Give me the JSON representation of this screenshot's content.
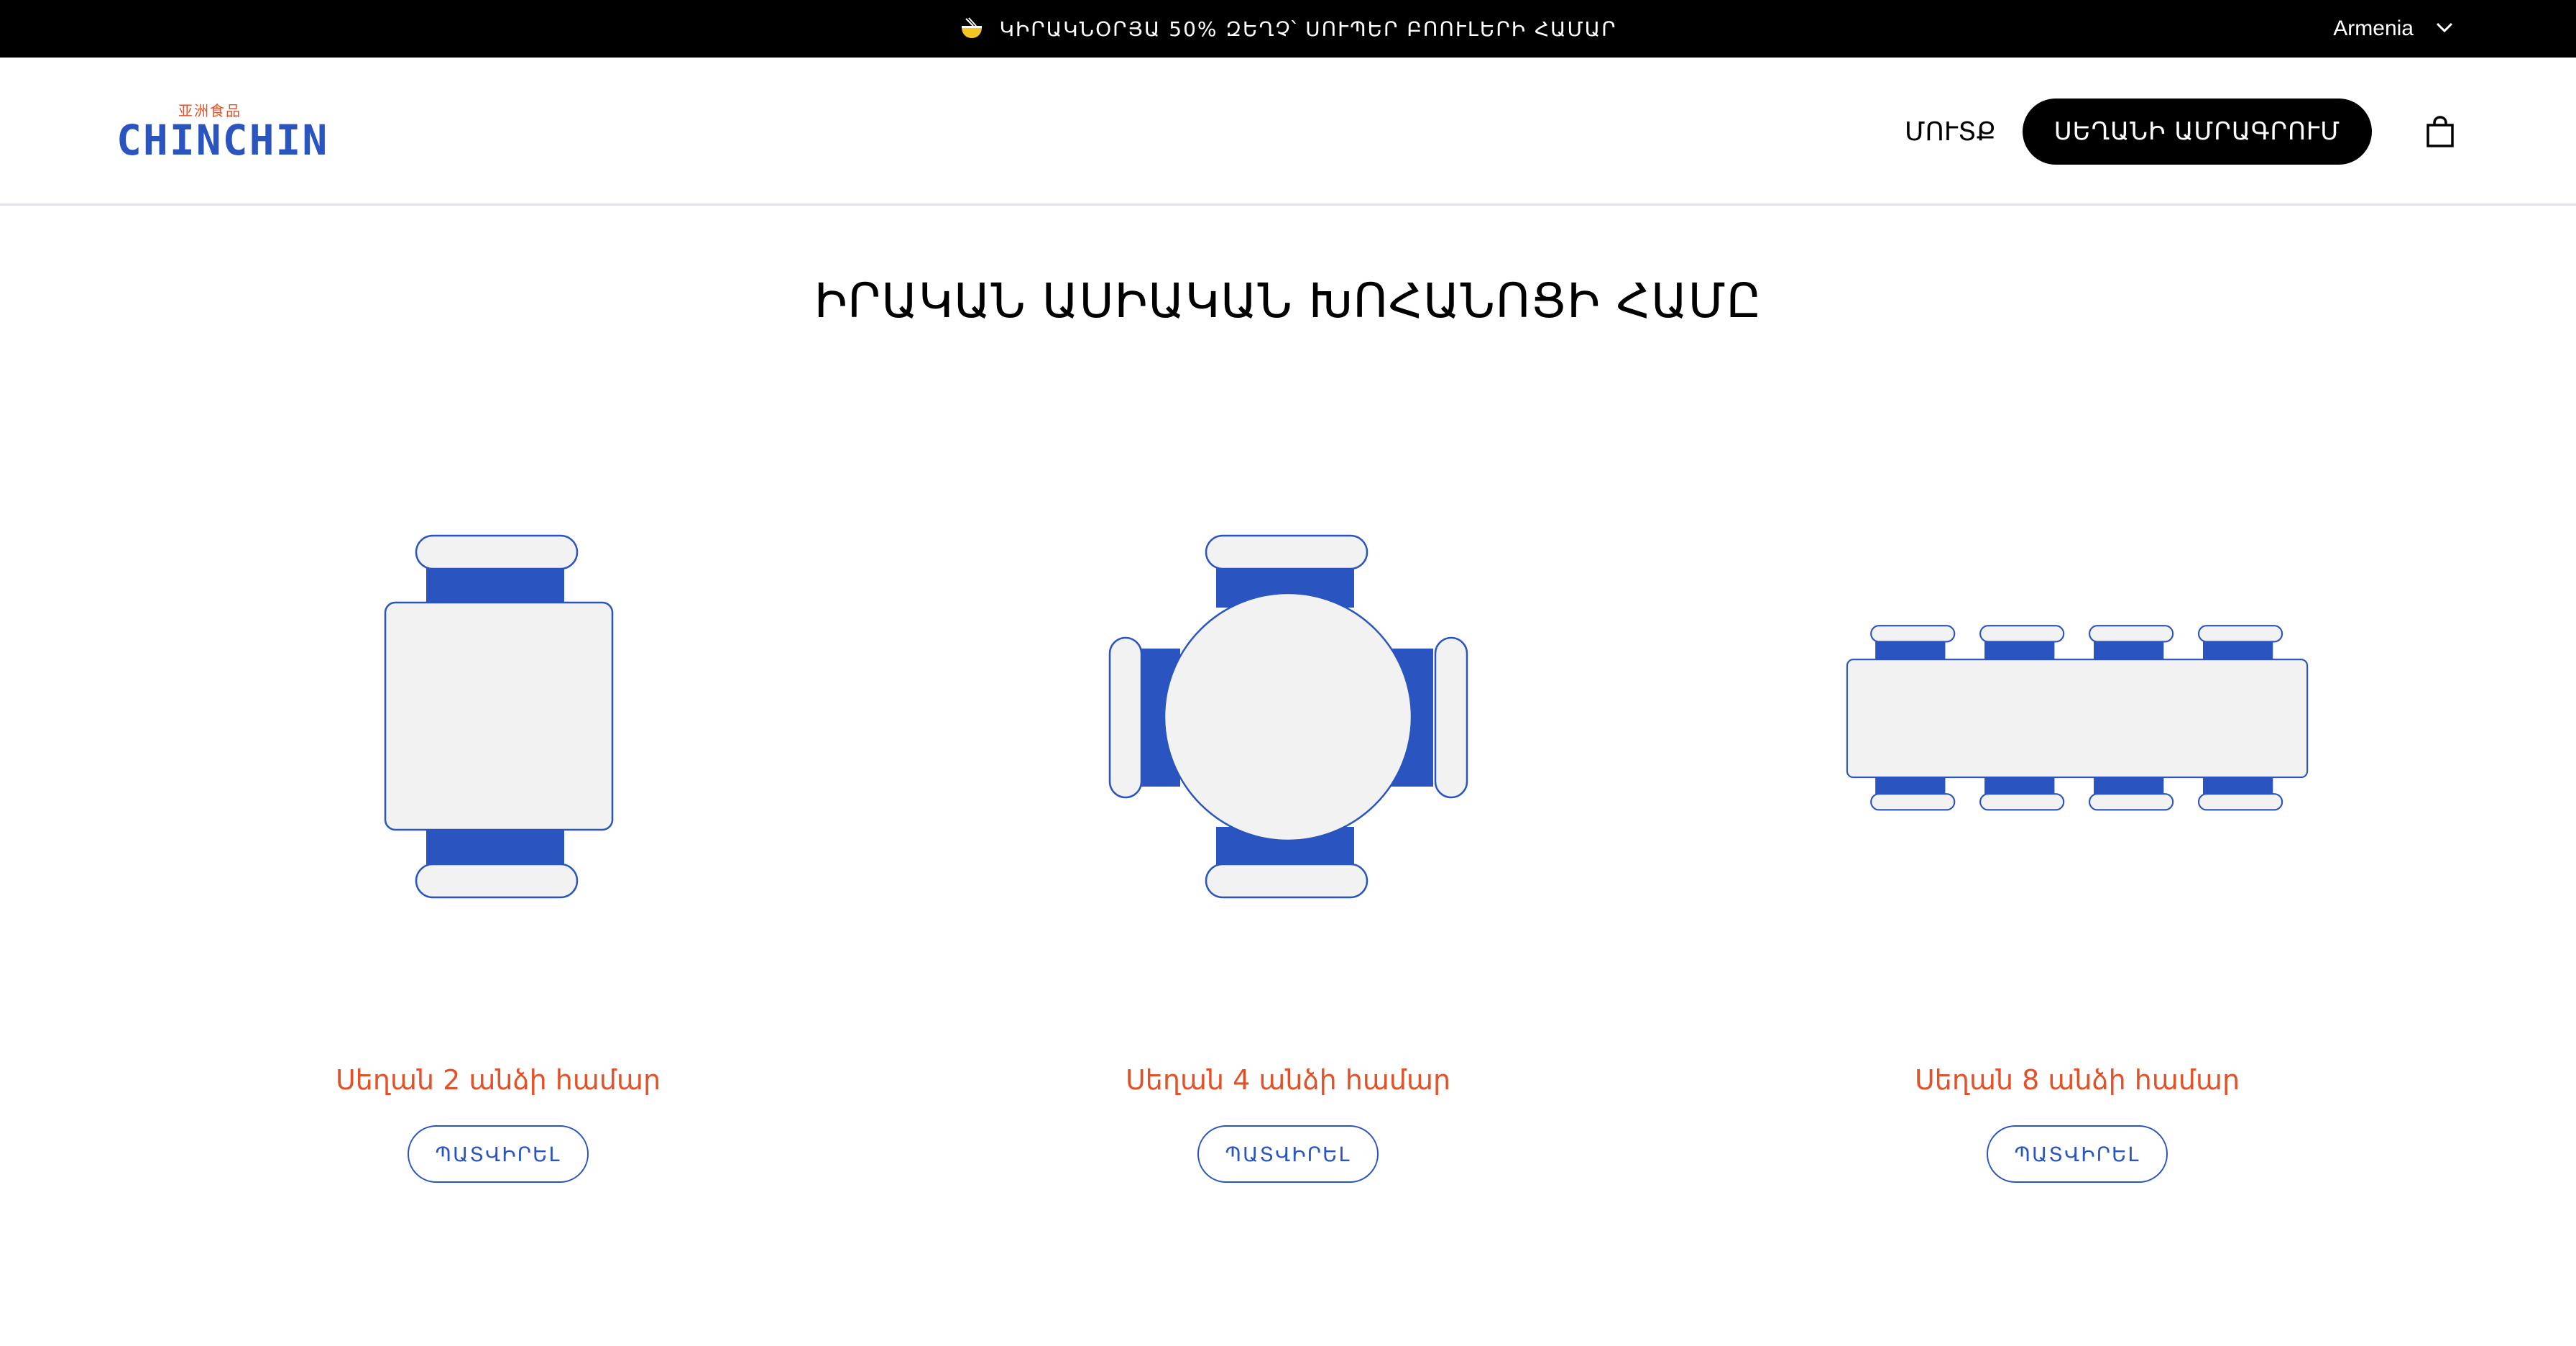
{
  "promo": {
    "icon": "noodle-bowl-icon",
    "text": "ԿԻՐԱԿՆՕՐՅԱ 50% ԶԵՂՉ՝ ՍՈՒՊԵՐ ԲՈՈՒԼԵՐԻ ՀԱՄԱՐ"
  },
  "country": {
    "selected": "Armenia",
    "icon": "chevron-down-icon"
  },
  "header": {
    "logo_cn": "亚洲食品",
    "logo_word": "CHINCHIN",
    "login_label": "ՄՈՒՏՔ",
    "reserve_label": "ՍԵՂԱՆԻ ԱՄՐԱԳՐՈՒՄ",
    "cart_icon": "shopping-bag-icon"
  },
  "main": {
    "title": "ԻՐԱԿԱՆ ԱՍԻԱԿԱՆ ԽՈՀԱՆՈՑԻ ՀԱՄԸ",
    "tables": [
      {
        "label": "Սեղան 2 անձի համար",
        "button": "ՊԱՏՎԻՐԵԼ",
        "icon": "table-2-seats-icon"
      },
      {
        "label": "Սեղան 4 անձի համար",
        "button": "ՊԱՏՎԻՐԵԼ",
        "icon": "table-4-seats-icon"
      },
      {
        "label": "Սեղան 8 անձի համար",
        "button": "ՊԱՏՎԻՐԵԼ",
        "icon": "table-8-seats-icon"
      }
    ]
  },
  "colors": {
    "brand_blue": "#2a55c0",
    "accent_orange": "#e2522a",
    "table_fill": "#f2f2f2",
    "promo_bg": "#000000"
  }
}
